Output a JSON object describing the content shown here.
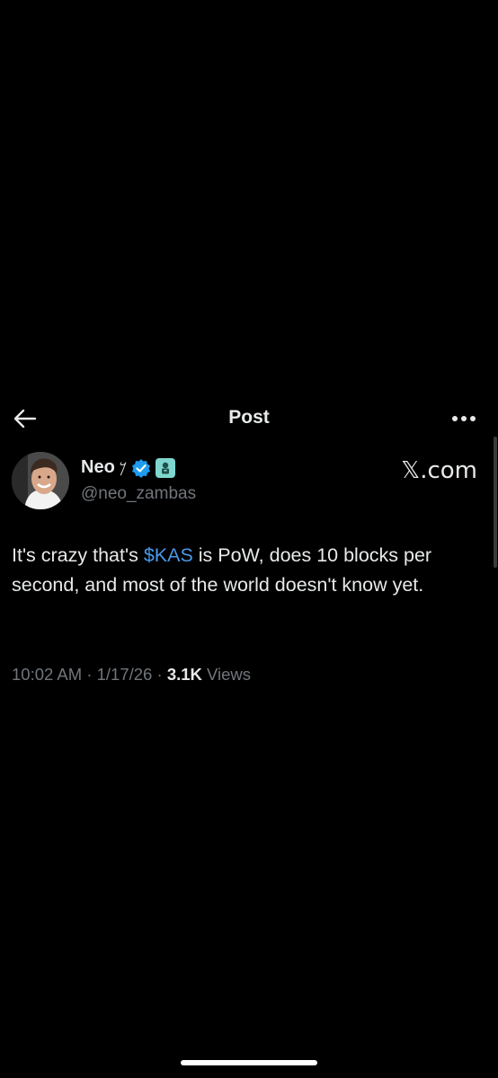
{
  "header": {
    "title": "Post",
    "back_icon": "arrow-left-icon",
    "more_icon": "more-horizontal-icon"
  },
  "author": {
    "display_name": "Neo",
    "name_glyph": "𐤊",
    "handle": "@neo_zambas",
    "verified_color": "#1d9bf0",
    "affiliate_badge_color": "#7fd6cf",
    "source_mark": "𝕏.com"
  },
  "post": {
    "text_before": "It's crazy that's ",
    "cashtag": "$KAS",
    "text_after": " is PoW, does 10 blocks per second, and most of the world doesn't know yet.",
    "cashtag_color": "#4a99e9"
  },
  "meta": {
    "time": "10:02 AM",
    "separator": "·",
    "date": "1/17/26",
    "views_count": "3.1K",
    "views_label": "Views"
  },
  "colors": {
    "background": "#000000",
    "text_primary": "#e7e9ea",
    "text_secondary": "#71767b"
  }
}
